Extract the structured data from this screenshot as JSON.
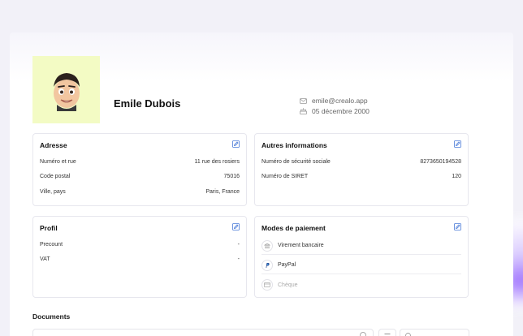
{
  "profile": {
    "name": "Emile Dubois",
    "email": "emile@crealo.app",
    "birthdate": "05 décembre 2000"
  },
  "address": {
    "title": "Adresse",
    "rows": [
      {
        "label": "Numéro et rue",
        "value": "11 rue des rosiers"
      },
      {
        "label": "Code postal",
        "value": "75016"
      },
      {
        "label": "Ville, pays",
        "value": "Paris, France"
      }
    ]
  },
  "other_info": {
    "title": "Autres informations",
    "rows": [
      {
        "label": "Numéro de sécurité sociale",
        "value": "8273650194528"
      },
      {
        "label": "Numéro de SIRET",
        "value": "120"
      }
    ]
  },
  "profil": {
    "title": "Profil",
    "rows": [
      {
        "label": "Precount",
        "value": "-"
      },
      {
        "label": "VAT",
        "value": "-"
      }
    ]
  },
  "payment": {
    "title": "Modes de paiement",
    "methods": [
      {
        "label": "Virement bancaire",
        "icon": "bank-icon"
      },
      {
        "label": "PayPal",
        "icon": "paypal-icon"
      },
      {
        "label": "Chèque",
        "icon": "card-icon"
      }
    ]
  },
  "documents": {
    "title": "Documents"
  },
  "colors": {
    "accent": "#4a7bd8",
    "avatar_bg": "#f3fbc4",
    "paypal_blue": "#1f3d8c"
  }
}
